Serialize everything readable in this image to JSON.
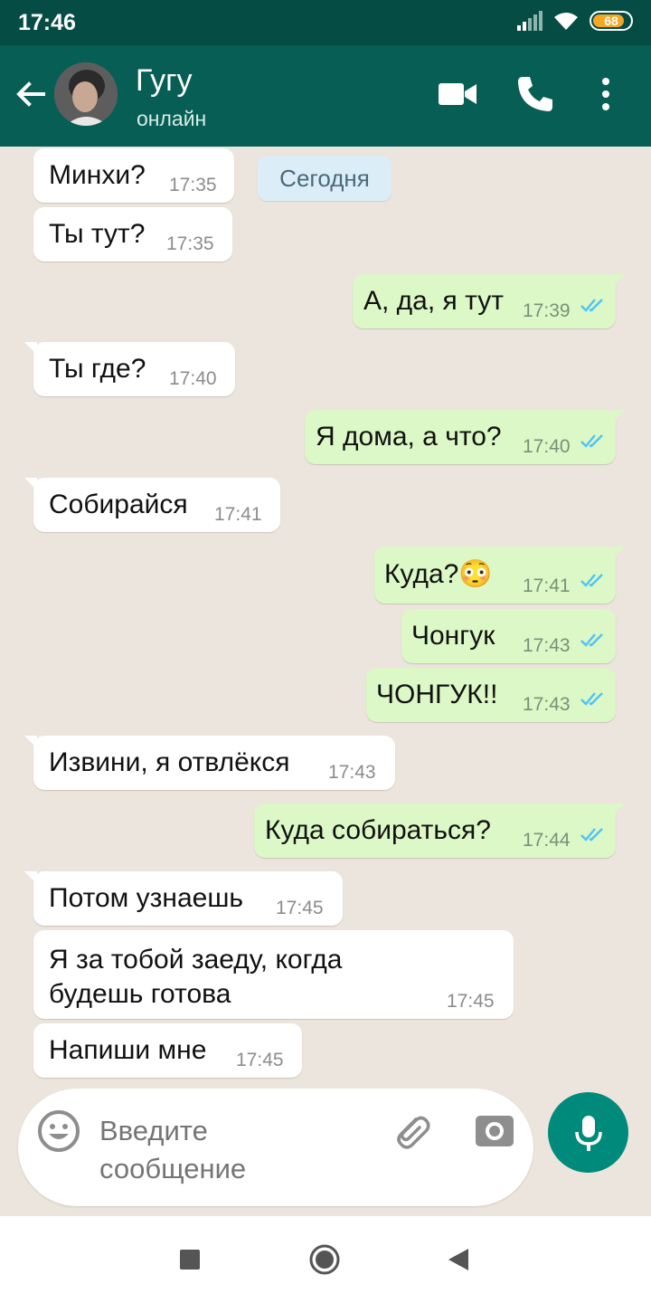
{
  "status_bar": {
    "time": "17:46",
    "battery": "68"
  },
  "header": {
    "contact_name": "Гугу",
    "contact_status": "онлайн"
  },
  "date_divider": "Сегодня",
  "messages": [
    {
      "direction": "in",
      "text": "Минхи?",
      "time": "17:35"
    },
    {
      "direction": "in",
      "text": "Ты тут?",
      "time": "17:35"
    },
    {
      "direction": "out",
      "text": "А, да, я тут",
      "time": "17:39",
      "read": true
    },
    {
      "direction": "in",
      "text": "Ты где?",
      "time": "17:40"
    },
    {
      "direction": "out",
      "text": "Я дома, а что?",
      "time": "17:40",
      "read": true
    },
    {
      "direction": "in",
      "text": "Собирайся",
      "time": "17:41"
    },
    {
      "direction": "out",
      "text": "Куда?😳",
      "time": "17:41",
      "read": true
    },
    {
      "direction": "out",
      "text": "Чонгук",
      "time": "17:43",
      "read": true
    },
    {
      "direction": "out",
      "text": "ЧОНГУК!!",
      "time": "17:43",
      "read": true
    },
    {
      "direction": "in",
      "text": "Извини, я отвлёкся",
      "time": "17:43"
    },
    {
      "direction": "out",
      "text": "Куда собираться?",
      "time": "17:44",
      "read": true
    },
    {
      "direction": "in",
      "text": "Потом узнаешь",
      "time": "17:45"
    },
    {
      "direction": "in",
      "text": "Я за тобой заеду, когда\nбудешь готова",
      "time": "17:45"
    },
    {
      "direction": "in",
      "text": "Напиши мне",
      "time": "17:45"
    }
  ],
  "input": {
    "placeholder": "Введите\nсообщение"
  },
  "colors": {
    "header": "#075e54",
    "status_bar": "#054d44",
    "outgoing_bubble": "#dcf8c6",
    "incoming_bubble": "#ffffff",
    "accent": "#008a7c",
    "read_tick": "#4fc3f7"
  },
  "icons": [
    "back-arrow-icon",
    "video-call-icon",
    "phone-icon",
    "more-vert-icon",
    "emoji-icon",
    "attach-icon",
    "camera-icon",
    "mic-icon",
    "nav-square-icon",
    "nav-circle-icon",
    "nav-back-icon"
  ]
}
